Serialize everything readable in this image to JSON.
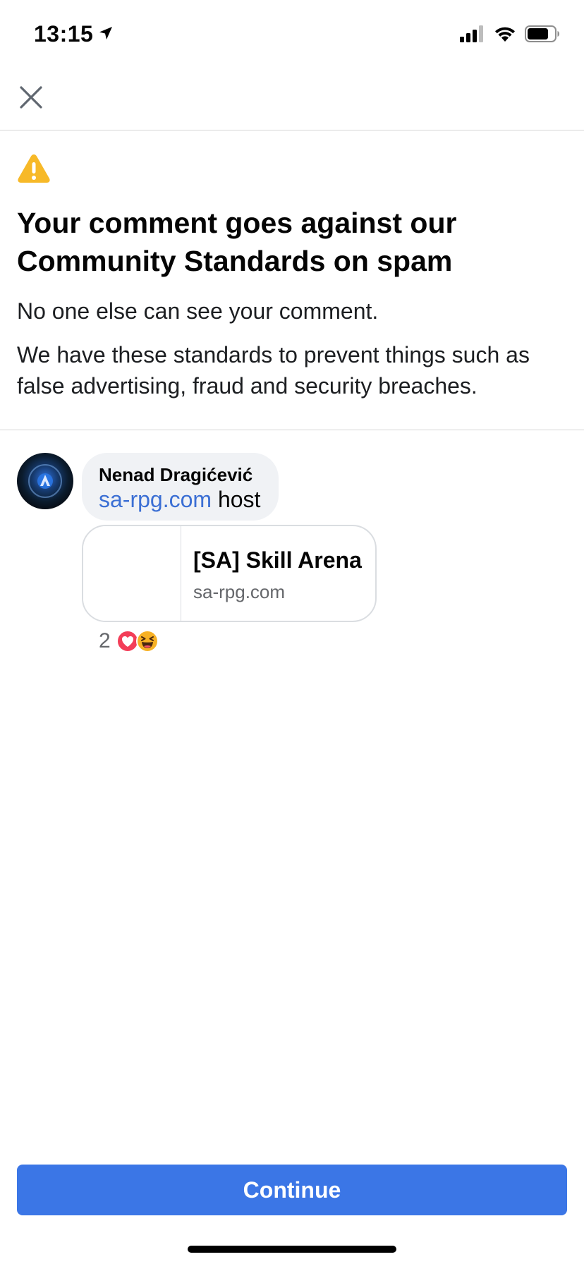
{
  "status_bar": {
    "time": "13:15",
    "icons": [
      "location-arrow-icon",
      "cellular-signal-icon",
      "wifi-icon",
      "battery-icon"
    ]
  },
  "header": {
    "close_icon": "close-icon"
  },
  "warning": {
    "icon": "warning-triangle-icon",
    "icon_color": "#F7B928",
    "title": "Your comment goes against our Community Standards on spam",
    "para1": "No one else can see your comment.",
    "para2": "We have these standards to prevent things such as false advertising, fraud and security breaches."
  },
  "comment": {
    "author": "Nenad Dragićević",
    "link_text": "sa-rpg.com",
    "rest_text": " host",
    "link_color": "#3B6FD4",
    "card": {
      "title": "[SA] Skill Arena",
      "domain": "sa-rpg.com"
    },
    "reactions": {
      "count": "2",
      "icons": [
        "love-reaction-icon",
        "haha-reaction-icon"
      ]
    }
  },
  "footer": {
    "continue_label": "Continue",
    "button_color": "#3B76E6"
  }
}
